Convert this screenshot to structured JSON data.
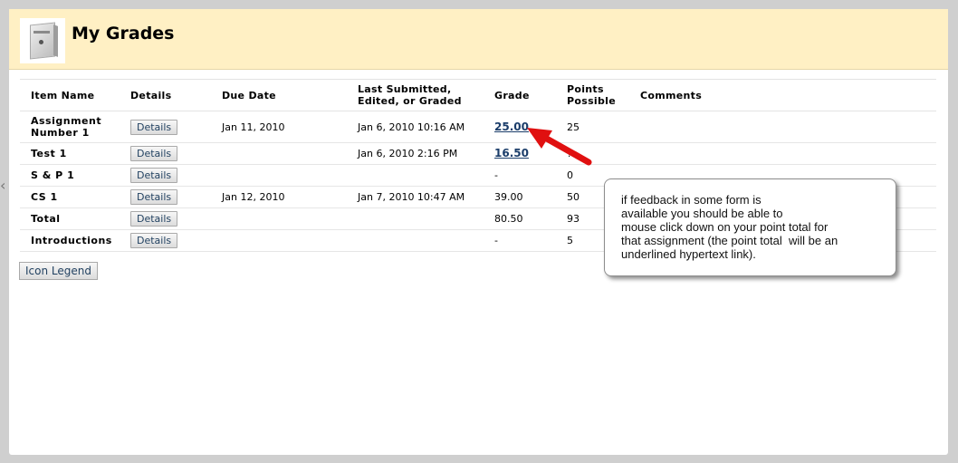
{
  "page": {
    "title": "My Grades"
  },
  "table": {
    "headers": {
      "item_name": "Item Name",
      "details": "Details",
      "due_date": "Due Date",
      "last_submitted_line1": "Last Submitted,",
      "last_submitted_line2": "Edited, or Graded",
      "grade": "Grade",
      "points_line1": "Points",
      "points_line2": "Possible",
      "comments": "Comments"
    },
    "rows": [
      {
        "name_line1": "Assignment",
        "name_line2": "Number 1",
        "details": "Details",
        "due": "Jan 11, 2010",
        "last": "Jan 6, 2010 10:16 AM",
        "grade": "25.00",
        "points": "25"
      },
      {
        "name": "Test 1",
        "details": "Details",
        "due": "",
        "last": "Jan 6, 2010 2:16 PM",
        "grade": "16.50",
        "points": "?"
      },
      {
        "name": "S & P 1",
        "details": "Details",
        "due": "",
        "last": "",
        "grade": "-",
        "points": "0"
      },
      {
        "name": "CS 1",
        "details": "Details",
        "due": "Jan 12, 2010",
        "last": "Jan 7, 2010 10:47 AM",
        "grade": "39.00",
        "points": "50"
      },
      {
        "name": "Total",
        "details": "Details",
        "due": "",
        "last": "",
        "grade": "80.50",
        "points": "93"
      },
      {
        "name": "Introductions",
        "details": "Details",
        "due": "",
        "last": "",
        "grade": "-",
        "points": "5"
      }
    ]
  },
  "icon_legend_label": "Icon Legend",
  "callout": {
    "lines": [
      "if feedback in some form is",
      "available you should be able to",
      "mouse click down on your point total for",
      "that assignment (the point total  will be an",
      "underlined hypertext link)."
    ]
  },
  "icons": {
    "left_chevron": "‹"
  },
  "colors": {
    "header_bg": "#fff0c4",
    "link": "#1b3d6a",
    "arrow": "#e01010"
  }
}
